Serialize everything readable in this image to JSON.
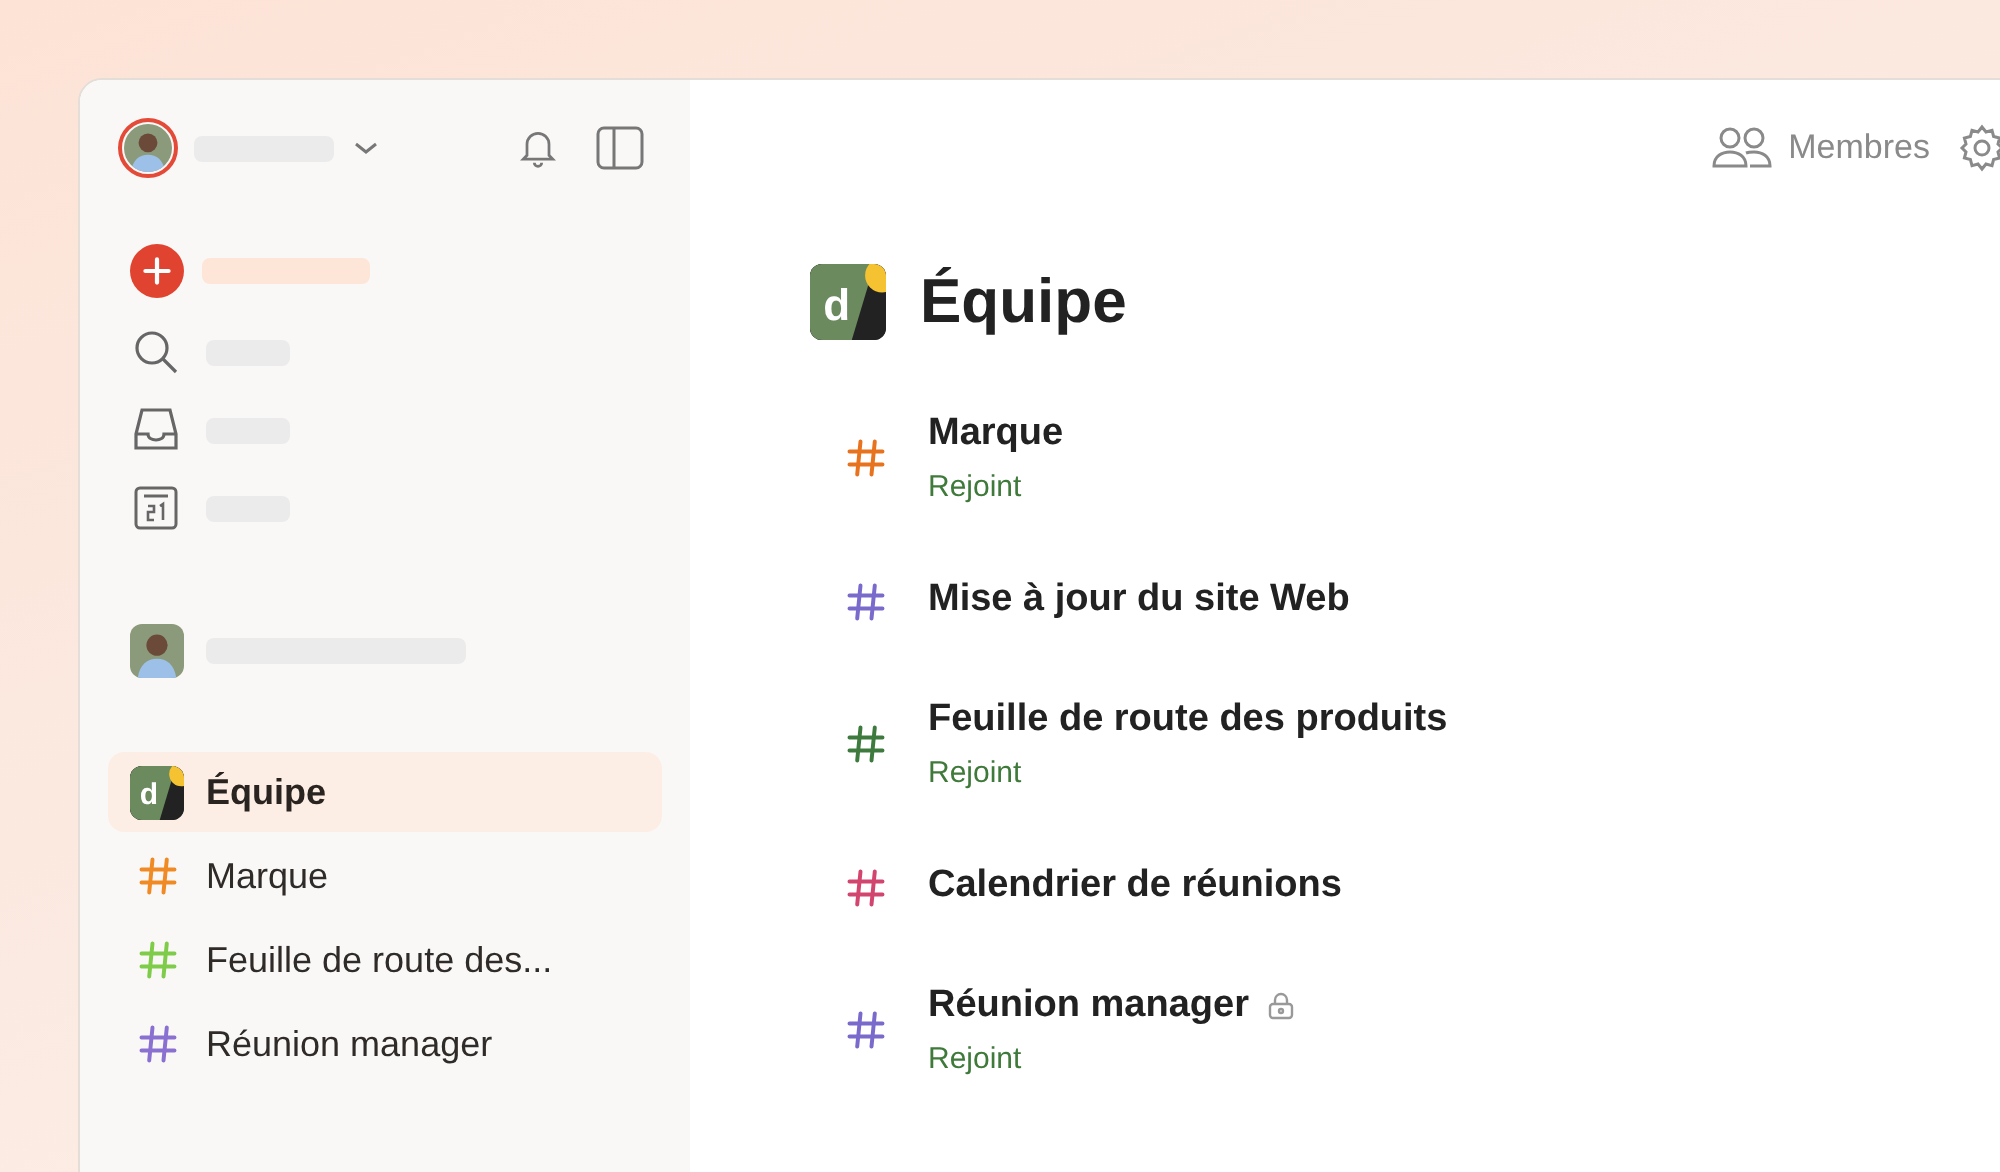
{
  "sidebar": {
    "items": [
      {
        "kind": "team",
        "label": "Équipe",
        "logo_letter": "d",
        "selected": true
      },
      {
        "kind": "channel",
        "label": "Marque",
        "color": "#f08a24",
        "selected": false
      },
      {
        "kind": "channel",
        "label": "Feuille de route des...",
        "color": "#7ecc49",
        "selected": false
      },
      {
        "kind": "channel",
        "label": "Réunion manager",
        "color": "#8a70d0",
        "selected": false
      }
    ]
  },
  "header": {
    "members_button": "Membres"
  },
  "team": {
    "title": "Équipe",
    "logo_letter": "d"
  },
  "channels": [
    {
      "name": "Marque",
      "color": "#e8731e",
      "status": "Rejoint",
      "locked": false
    },
    {
      "name": "Mise à jour du site Web",
      "color": "#7a6acc",
      "locked": false
    },
    {
      "name": "Feuille de route des produits",
      "color": "#3e7a3e",
      "status": "Rejoint",
      "locked": false
    },
    {
      "name": "Calendrier de réunions",
      "color": "#d1456e",
      "locked": false
    },
    {
      "name": "Réunion manager",
      "color": "#7a6acc",
      "status": "Rejoint",
      "locked": true
    }
  ]
}
